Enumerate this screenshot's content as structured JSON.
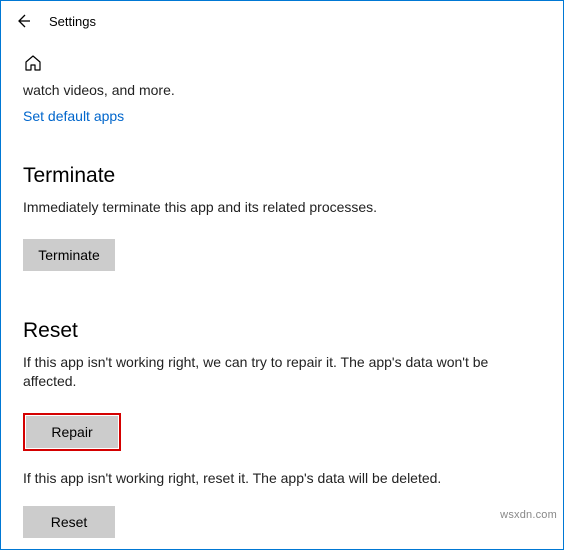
{
  "header": {
    "title": "Settings"
  },
  "top": {
    "truncated_text": "watch videos, and more.",
    "link_text": "Set default apps"
  },
  "terminate": {
    "title": "Terminate",
    "desc": "Immediately terminate this app and its related processes.",
    "button": "Terminate"
  },
  "reset": {
    "title": "Reset",
    "repair_desc": "If this app isn't working right, we can try to repair it. The app's data won't be affected.",
    "repair_button": "Repair",
    "reset_desc": "If this app isn't working right, reset it. The app's data will be deleted.",
    "reset_button": "Reset"
  },
  "watermark": "wsxdn.com"
}
